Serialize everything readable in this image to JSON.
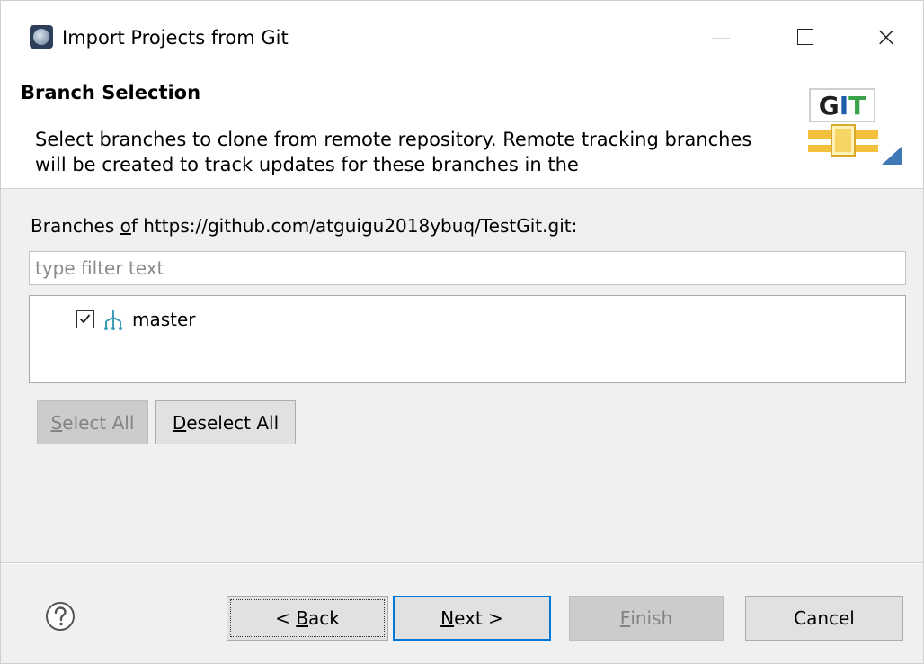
{
  "window": {
    "title": "Import Projects from Git",
    "controls": {
      "minimize": "minimize",
      "maximize": "maximize",
      "close": "×"
    }
  },
  "header": {
    "title": "Branch Selection",
    "description": "Select branches to clone from remote repository. Remote tracking branches will be created to track updates for these branches in the",
    "logo_text": "GIT"
  },
  "content": {
    "branches_label_prefix": "Branches ",
    "branches_label_mnemonic": "o",
    "branches_label_suffix": "f https://github.com/atguigu2018ybuq/TestGit.git:",
    "filter": {
      "value": "",
      "placeholder": "type filter text"
    },
    "branches": [
      {
        "name": "master",
        "checked": true
      }
    ],
    "buttons": {
      "select_all_mnemonic": "S",
      "select_all_rest": "elect All",
      "select_all_enabled": false,
      "deselect_all_mnemonic": "D",
      "deselect_all_rest": "eselect All",
      "deselect_all_enabled": true
    }
  },
  "footer": {
    "back_prefix": "< ",
    "back_mnemonic": "B",
    "back_rest": "ack",
    "next_mnemonic": "N",
    "next_rest": "ext >",
    "finish_mnemonic": "F",
    "finish_rest": "inish",
    "finish_enabled": false,
    "cancel": "Cancel"
  },
  "colors": {
    "focus_border": "#0078d7",
    "branch_icon": "#3f9fb8",
    "git_logo_yellow": "#f2c03a",
    "git_logo_green": "#3aa34a",
    "git_logo_blue": "#1f5fa8"
  },
  "icons": {
    "app": "eclipse-icon",
    "branch": "branch-icon",
    "help": "help-icon",
    "checkbox": "checkmark-icon"
  }
}
